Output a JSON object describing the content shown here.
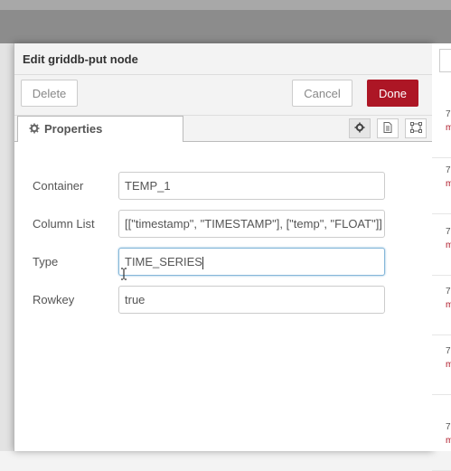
{
  "tray": {
    "title": "Edit griddb-put node",
    "delete_label": "Delete",
    "cancel_label": "Cancel",
    "done_label": "Done",
    "accent_color": "#ad1625"
  },
  "tabs": {
    "properties_label": "Properties",
    "properties_icon": "gear-icon",
    "side_buttons": [
      "gear-icon",
      "document-icon",
      "frame-icon"
    ]
  },
  "form": {
    "container": {
      "label": "Container",
      "value": "TEMP_1"
    },
    "column_list": {
      "label": "Column List",
      "value": "[[\"timestamp\", \"TIMESTAMP\"], [\"temp\", \"FLOAT\"]]"
    },
    "type": {
      "label": "Type",
      "value": "TIME_SERIES"
    },
    "rowkey": {
      "label": "Rowkey",
      "value": "true"
    }
  },
  "right_panel": {
    "items": [
      {
        "num": "7",
        "m": "m"
      },
      {
        "num": "7",
        "m": "m"
      },
      {
        "num": "7",
        "m": "m"
      },
      {
        "num": "7",
        "m": "m"
      },
      {
        "num": "7",
        "m": "m"
      },
      {
        "num": "7",
        "m": "m"
      }
    ]
  }
}
